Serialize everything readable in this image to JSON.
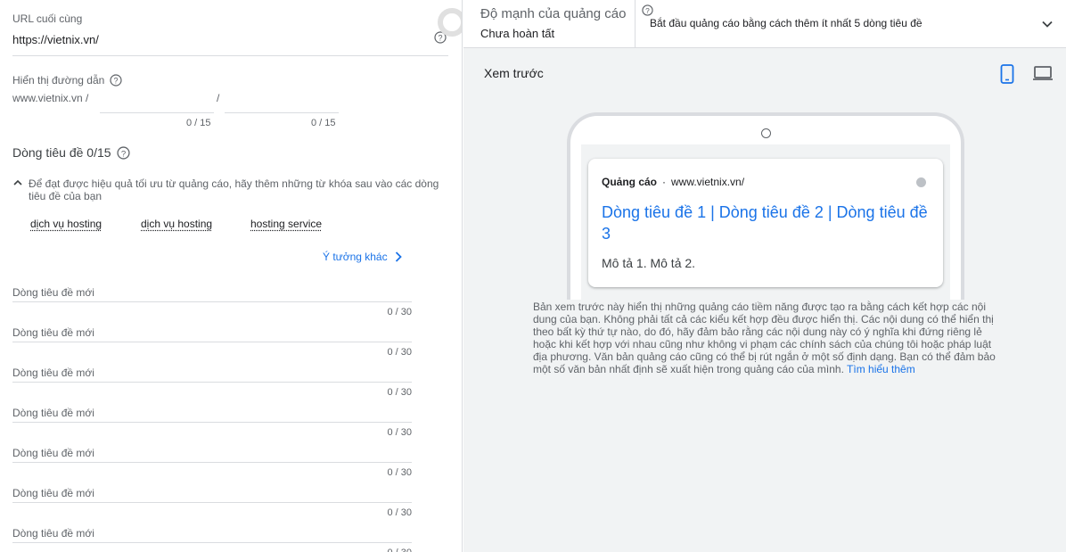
{
  "final_url": {
    "label": "URL cuối cùng",
    "value": "https://vietnix.vn/"
  },
  "display_path": {
    "label": "Hiển thị đường dẫn",
    "base": "www.vietnix.vn /",
    "separator": "/",
    "path1_count": "0 / 15",
    "path2_count": "0 / 15"
  },
  "headlines": {
    "title": "Dòng tiêu đề 0/15",
    "tip": "Để đạt được hiệu quả tối ưu từ quảng cáo, hãy thêm những từ khóa sau vào các dòng tiêu đề của bạn",
    "keywords": [
      "dịch vụ hosting",
      "dịch vụ hosting",
      "hosting service"
    ],
    "more_ideas": "Ý tưởng khác",
    "placeholder": "Dòng tiêu đề mới",
    "count": "0 / 30"
  },
  "ad_strength": {
    "title": "Độ mạnh của quảng cáo",
    "status": "Chưa hoàn tất",
    "message": "Bắt đầu quảng cáo bằng cách thêm ít nhất 5 dòng tiêu đề"
  },
  "preview": {
    "label": "Xem trước",
    "ad_label": "Quảng cáo",
    "ad_url": "www.vietnix.vn/",
    "ad_title": "Dòng tiêu đề 1 | Dòng tiêu đề 2 | Dòng tiêu đề 3",
    "ad_description": "Mô tả 1. Mô tả 2.",
    "disclaimer": "Bản xem trước này hiển thị những quảng cáo tiềm năng được tạo ra bằng cách kết hợp các nội dung của bạn. Không phải tất cả các kiểu kết hợp đều được hiển thị. Các nội dung có thể hiển thị theo bất kỳ thứ tự nào, do đó, hãy đảm bảo rằng các nội dung này có ý nghĩa khi đứng riêng lẻ hoặc khi kết hợp với nhau cũng như không vi phạm các chính sách của chúng tôi hoặc pháp luật địa phương. Văn bản quảng cáo cũng có thể bị rút ngắn ở một số định dạng. Bạn có thể đảm bảo một số văn bản nhất định sẽ xuất hiện trong quảng cáo của mình.",
    "learn_more": "Tìm hiểu thêm"
  },
  "colors": {
    "accent": "#1a73e8",
    "panel_bg": "#f1f3f4"
  },
  "icons": [
    "help-icon",
    "chevron-up-icon",
    "chevron-right-icon",
    "chevron-down-icon",
    "mobile-icon",
    "laptop-icon"
  ]
}
